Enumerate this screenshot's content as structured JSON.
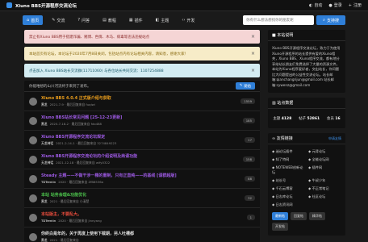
{
  "topbar": {
    "site_name": "Xiuno BBS开源程序交流论坛",
    "auto_label": "自动",
    "login_label": "登录",
    "register_label": "注册"
  },
  "nav": {
    "items": [
      {
        "label": "首页",
        "active": true
      },
      {
        "label": "交流"
      },
      {
        "label": "问答"
      },
      {
        "label": "教程"
      },
      {
        "label": "插件"
      },
      {
        "label": "主题"
      },
      {
        "label": "开发"
      }
    ],
    "search_placeholder": "你有什么想法想找你的朋友呢",
    "search_button": "支持搜"
  },
  "alerts": [
    {
      "text": "禁止有Xiuno BBS用于搭建诈骗、赌博、色情、木马、病毒等违法违规站点",
      "color": "red"
    },
    {
      "text": "本站首页有论坛，本论坛于2020年7月8日关闭，包括站点内有论坛相关内容，请知悉，感谢大家！",
      "color": "yellow"
    },
    {
      "text": "点击加入 Xiuno BBS站长交流群(11711060) 与各位站长共同交流：1107254888",
      "color": "blue"
    }
  ],
  "list": {
    "header": "你能唯想的山川河流终于来到了发布。",
    "post_button": "发帖"
  },
  "threads": [
    {
      "title": "Xiuno BBS 4.0.4 正式版介绍与获取",
      "author": "黑龙",
      "meta": "2021-7-9 · 最后回复来自 fuqiwi",
      "count": "1559",
      "color": "#e89c1c"
    },
    {
      "title": "Xiuno BBS站长常见问题 [25-12-23更新]",
      "author": "黑龙",
      "meta": "2020-7-18-2 · 最后回复来自 fdo488",
      "count": "185",
      "color": "#9b59e0"
    },
    {
      "title": "Xiuno BBS开源程序交流论坛规定",
      "author": "天龙神话",
      "meta": "2021-2-14-1 · 最后回复来自 3274849223",
      "count": "17",
      "color": "#9b59e0"
    },
    {
      "title": "Xiuno BBS开源程序交流论坛的介绍说明及商请功能",
      "author": "天龙神话",
      "meta": "2021-12-18 · 最后回复来自 wify0322",
      "count": "158",
      "color": "#9b59e0"
    },
    {
      "title": "Steady 主题——不做干涉一棵的重制，只有正直纯——的基线 [请群超版]",
      "author": "TDTrentin",
      "meta": "2020 · 最后回复来自 ZfB8536a",
      "count": "88",
      "color": "#9b59e0"
    },
    {
      "title": "本站 站务会理&功能优化",
      "author": "黑龙",
      "meta": "2021 · 最后回复来自 小清楚",
      "count": "32",
      "color": "#4cc24c"
    },
    {
      "title": "本站版主，不要乱大。",
      "author": "TDTrentin",
      "meta": "2020 · 最后回复来自 jinnyang",
      "count": "1",
      "color": "#e74c3c"
    },
    {
      "title": "你终白是年的，关于再度上使用下载期，另人吐槽都",
      "author": "黑龙",
      "meta": "2021 · 最后回复来自",
      "count": "",
      "color": "#dddddd"
    }
  ],
  "side": {
    "intro_title": "本站说明",
    "intro_text": "Xiuno BBS开源程序交流论坛，致力于为使用Xiuno开源程序的站长提供有爱的Xiuno相关，Xiuno BBS、Xiuno程序交流，都有地分享给站长朋友们免费选择了大量的资源文件。本站为Xiuno程序爱好者，交出站长，你问题比大问题提出的公益性交流论坛。站长邮箱:qianchangrijun@gmail.com 站长邮箱:cywenz@gmail.com",
    "stats_title": "站点数据",
    "stats": [
      {
        "label": "主题",
        "value": "4128"
      },
      {
        "label": "帖子",
        "value": "52861"
      },
      {
        "label": "会员",
        "value": "16"
      }
    ],
    "links_title": "友情链接",
    "links_more": "申请友情",
    "links": [
      "迷论坛插件",
      "元背论坛",
      "知了特网",
      "全能论坛网",
      "NOTEWEB创新论坛",
      "插件网",
      "站长号",
      "牛叔少年",
      "千石云博客",
      "不正常笔记",
      "日志库论坛",
      "社区论坛",
      "日志资讯网"
    ],
    "tags": [
      {
        "label": "最新帖",
        "dark": false
      },
      {
        "label": "回复帖",
        "dark": true
      },
      {
        "label": "精华帖",
        "dark": true
      },
      {
        "label": "开发帖",
        "dark": true
      }
    ]
  },
  "colors": {
    "accent": "#2f7fd8",
    "background": "#1a1a1a",
    "panel": "#111111"
  }
}
